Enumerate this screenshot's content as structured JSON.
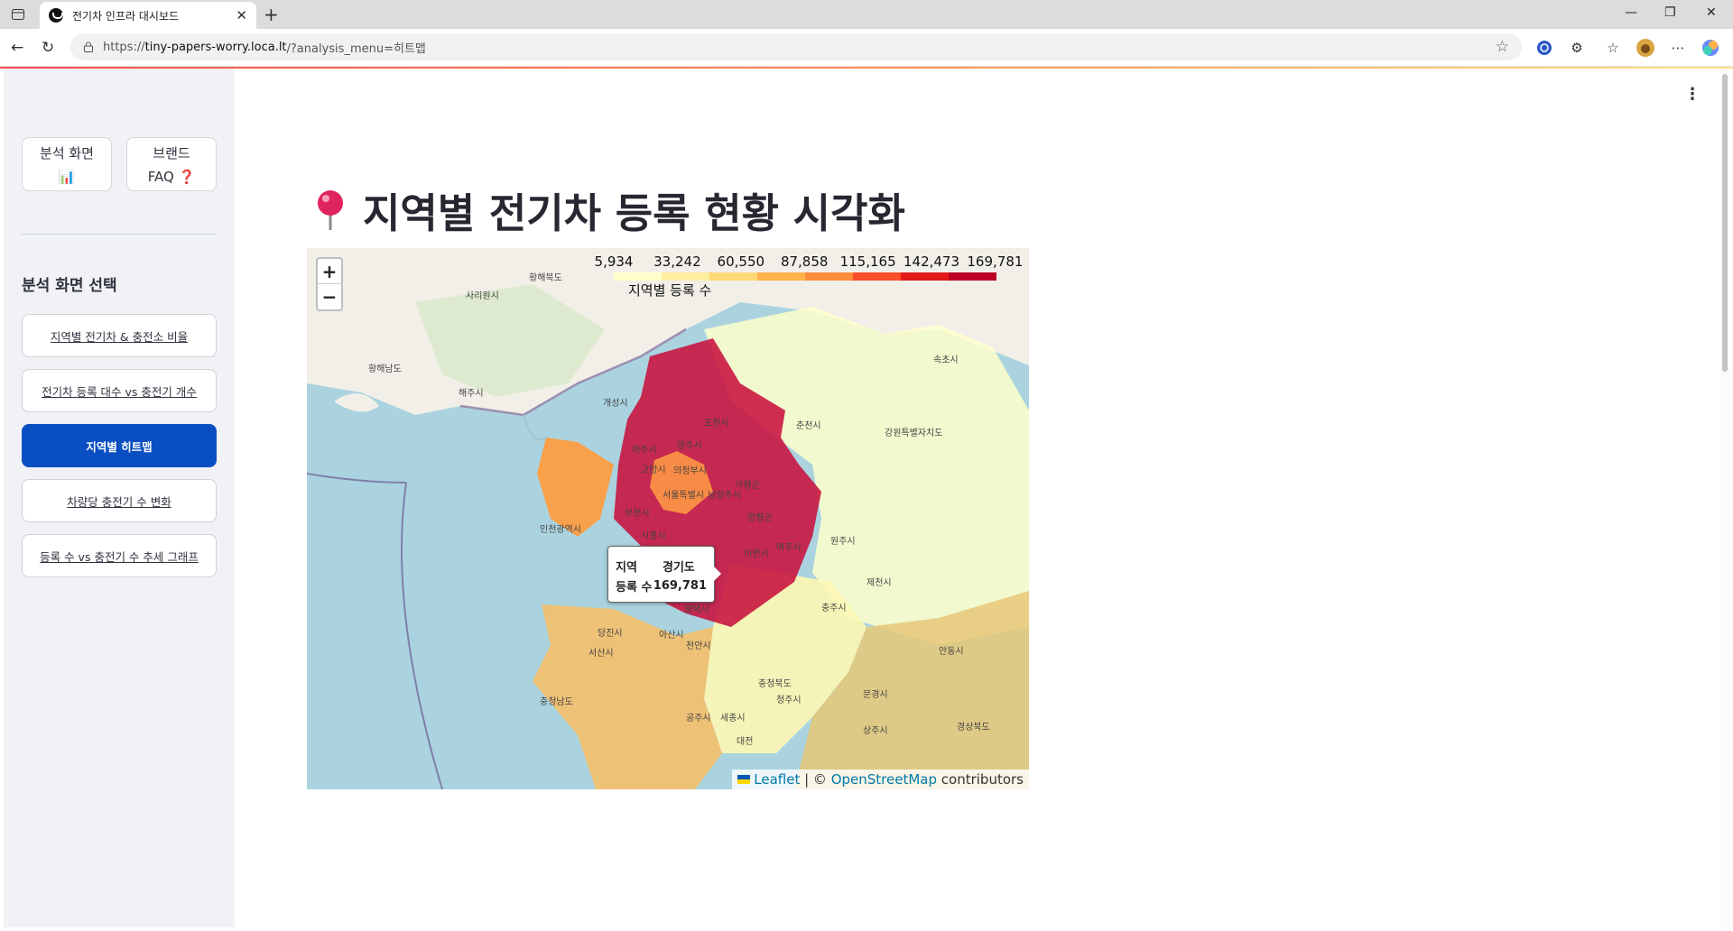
{
  "browser": {
    "tab_title": "전기차 인프라 대시보드",
    "url_scheme": "https://",
    "url_host": "tiny-papers-worry.loca.lt",
    "url_rest": "/?analysis_menu=히트맵"
  },
  "sidebar": {
    "top_buttons": [
      {
        "line1": "분석 화면",
        "line2": "📊"
      },
      {
        "line1": "브랜드",
        "line2": "FAQ ❓"
      }
    ],
    "section_title": "분석 화면 선택",
    "menu": [
      {
        "label": "지역별 전기차 & 충전소 비율",
        "active": false
      },
      {
        "label": "전기차 등록 대수 vs 충전기 개수",
        "active": false
      },
      {
        "label": "지역별 히트맵",
        "active": true
      },
      {
        "label": "차량당 충전기 수 변화",
        "active": false
      },
      {
        "label": "등록 수 vs 충전기 수 추세 그래프",
        "active": false
      }
    ]
  },
  "main": {
    "title": "지역별 전기차 등록 현황 시각화"
  },
  "map": {
    "zoom_in": "+",
    "zoom_out": "−",
    "legend_ticks": [
      "5,934",
      "33,242",
      "60,550",
      "87,858",
      "115,165",
      "142,473",
      "169,781"
    ],
    "legend_caption": "지역별 등록 수",
    "legend_colors": [
      "#ffffcc",
      "#ffeda0",
      "#fed976",
      "#feb24c",
      "#fd8d3c",
      "#fc4e2a",
      "#e31a1c",
      "#bd0026"
    ],
    "tooltip": {
      "region_key": "지역",
      "region_value": "경기도",
      "count_key": "등록 수",
      "count_value": "169,781"
    },
    "attribution": {
      "leaflet": "Leaflet",
      "separator": " | © ",
      "osm": "OpenStreetMap",
      "suffix": " contributors"
    },
    "place_labels": [
      "황해북도",
      "사리원시",
      "황해남도",
      "해주시",
      "개성시",
      "파주시",
      "양주시",
      "포천시",
      "고양시",
      "의정부시",
      "가평군",
      "인천광역시",
      "부천시",
      "서울특별시",
      "남양주시",
      "시흥시",
      "양평군",
      "이천시",
      "여주시",
      "평택시",
      "춘천시",
      "강원특별자치도",
      "원주시",
      "충주시",
      "제천시",
      "천안시",
      "서산시",
      "당진시",
      "충청남도",
      "아산시",
      "공주시",
      "세종시",
      "대전",
      "충청북도",
      "청주시",
      "문경시",
      "상주시",
      "경상북도",
      "안동시",
      "속초시"
    ]
  }
}
